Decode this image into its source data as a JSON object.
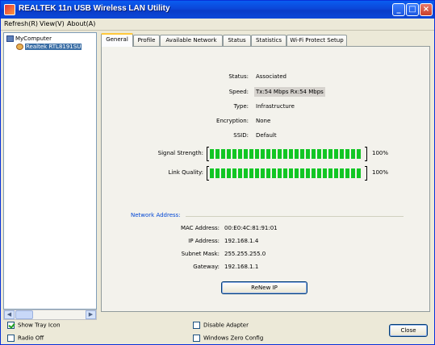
{
  "window": {
    "title": "REALTEK 11n USB Wireless LAN Utility",
    "controls": {
      "minimize": "_",
      "maximize": "□",
      "close": "×"
    }
  },
  "menu": {
    "items": [
      "Refresh(R)",
      "View(V)",
      "About(A)"
    ]
  },
  "tree": {
    "root": "MyComputer",
    "child": "Realtek RTL8191SU"
  },
  "tabs": [
    "General",
    "Profile",
    "Available Network",
    "Status",
    "Statistics",
    "Wi-Fi Protect Setup"
  ],
  "general": {
    "rows": [
      {
        "label": "Status:",
        "value": "Associated"
      },
      {
        "label": "Speed:",
        "value": "Tx:54 Mbps Rx:54 Mbps"
      },
      {
        "label": "Type:",
        "value": "Infrastructure"
      },
      {
        "label": "Encryption:",
        "value": "None"
      },
      {
        "label": "SSID:",
        "value": "Default"
      }
    ],
    "signal": {
      "label": "Signal Strength:",
      "level": 1.0,
      "percent": "100%"
    },
    "link": {
      "label": "Link Quality:",
      "level": 1.0,
      "percent": "100%"
    },
    "network_group": "Network Address:",
    "network": [
      {
        "label": "MAC Address:",
        "value": "00:E0:4C:81:91:01"
      },
      {
        "label": "IP Address:",
        "value": "192.168.1.4"
      },
      {
        "label": "Subnet Mask:",
        "value": "255.255.255.0"
      },
      {
        "label": "Gateway:",
        "value": "192.168.1.1"
      }
    ],
    "renew_button": "ReNew IP"
  },
  "footer": {
    "show_tray_icon": "Show Tray Icon",
    "radio_off": "Radio Off",
    "disable_adapter": "Disable Adapter",
    "windows_zero_config": "Windows Zero Config",
    "close_button": "Close"
  }
}
